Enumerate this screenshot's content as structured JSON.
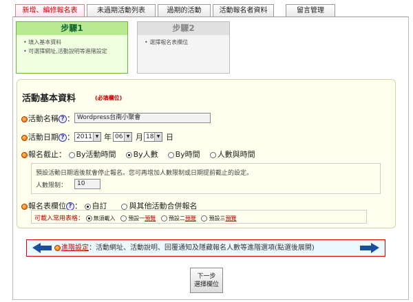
{
  "tabs": [
    {
      "label": "新增、編修報名表",
      "active": true
    },
    {
      "label": "未過期活動列表"
    },
    {
      "label": "過期的活動"
    },
    {
      "label": "活動報名者資料"
    },
    {
      "label": "留言管理"
    }
  ],
  "steps": {
    "step1": {
      "title": "步驟1",
      "items": [
        "填入基本資料",
        "可選擇網址,活動說明等進階設定"
      ]
    },
    "step2": {
      "title": "步驟2",
      "items": [
        "選擇報名表欄位"
      ]
    }
  },
  "form": {
    "section_title": "活動基本資料",
    "required_note": "(必填欄位)",
    "name_label": "活動名稱",
    "name_value": "Wordpress台南小聚會",
    "date_label": "活動日期",
    "year": "2011",
    "year_unit": "年",
    "month": "06",
    "month_unit": "月",
    "day": "18",
    "day_unit": "日",
    "deadline_label": "報名截止：",
    "deadline_options": [
      "By活動時間",
      "By人數",
      "By時間",
      "人數與時間"
    ],
    "deadline_note": "預設活動日期過後就會停止報名。您可再增加人數限制或日期提前截止的設定。",
    "limit_label": "人數限制：",
    "limit_value": "10",
    "fields_label": "報名表欄位",
    "fields_options": [
      "自訂",
      "與其他活動合併報名"
    ],
    "common_label": "可載入常用表格：",
    "common_options": [
      "無須載入",
      "預設一",
      "預設二",
      "預設三"
    ],
    "preview": "預覽"
  },
  "advanced": {
    "label": "進階設定",
    "text": "：活動網址、活動說明、回覆通知及隱藏報名人數等進階選項(點選後展開)"
  },
  "next_button": {
    "line1": "下一步",
    "line2": "選擇欄位"
  },
  "colors": {
    "accent": "#cc0000",
    "step1_bg": "#b8e890",
    "panel_bg": "#ffffee"
  }
}
